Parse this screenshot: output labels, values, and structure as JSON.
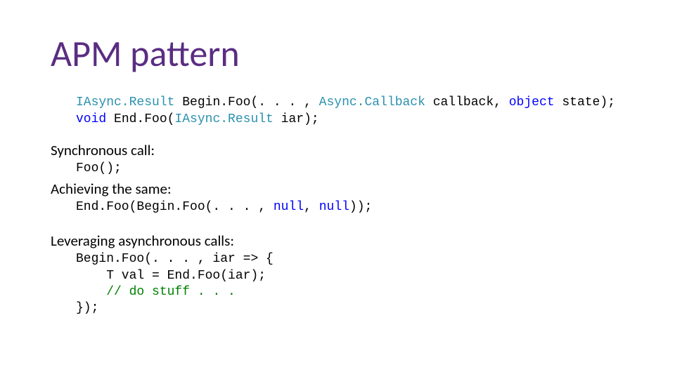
{
  "title": "APM pattern",
  "sig": {
    "l1": {
      "type": "IAsync.Result",
      "rest1": " Begin.Foo(. . . , ",
      "cbtype": "Async.Callback",
      "rest2": " callback, ",
      "kw": "object",
      "rest3": " state);"
    },
    "l2": {
      "kw": "void",
      "rest1": " End.Foo(",
      "type": "IAsync.Result",
      "rest2": " iar);"
    }
  },
  "sync_label": "Synchronous call:",
  "sync_code": "Foo();",
  "achieve_label": "Achieving the same:",
  "achieve_code": {
    "p1": "End.Foo(Begin.Foo(. . . , ",
    "n1": "null",
    "p2": ", ",
    "n2": "null",
    "p3": "));"
  },
  "leverage_label": "Leveraging asynchronous calls:",
  "lev": {
    "l1": "Begin.Foo(. . . , iar => {",
    "l2": "    T val = End.Foo(iar);",
    "l3p": "    ",
    "l3c": "// do stuff . . .",
    "l4": "});"
  }
}
